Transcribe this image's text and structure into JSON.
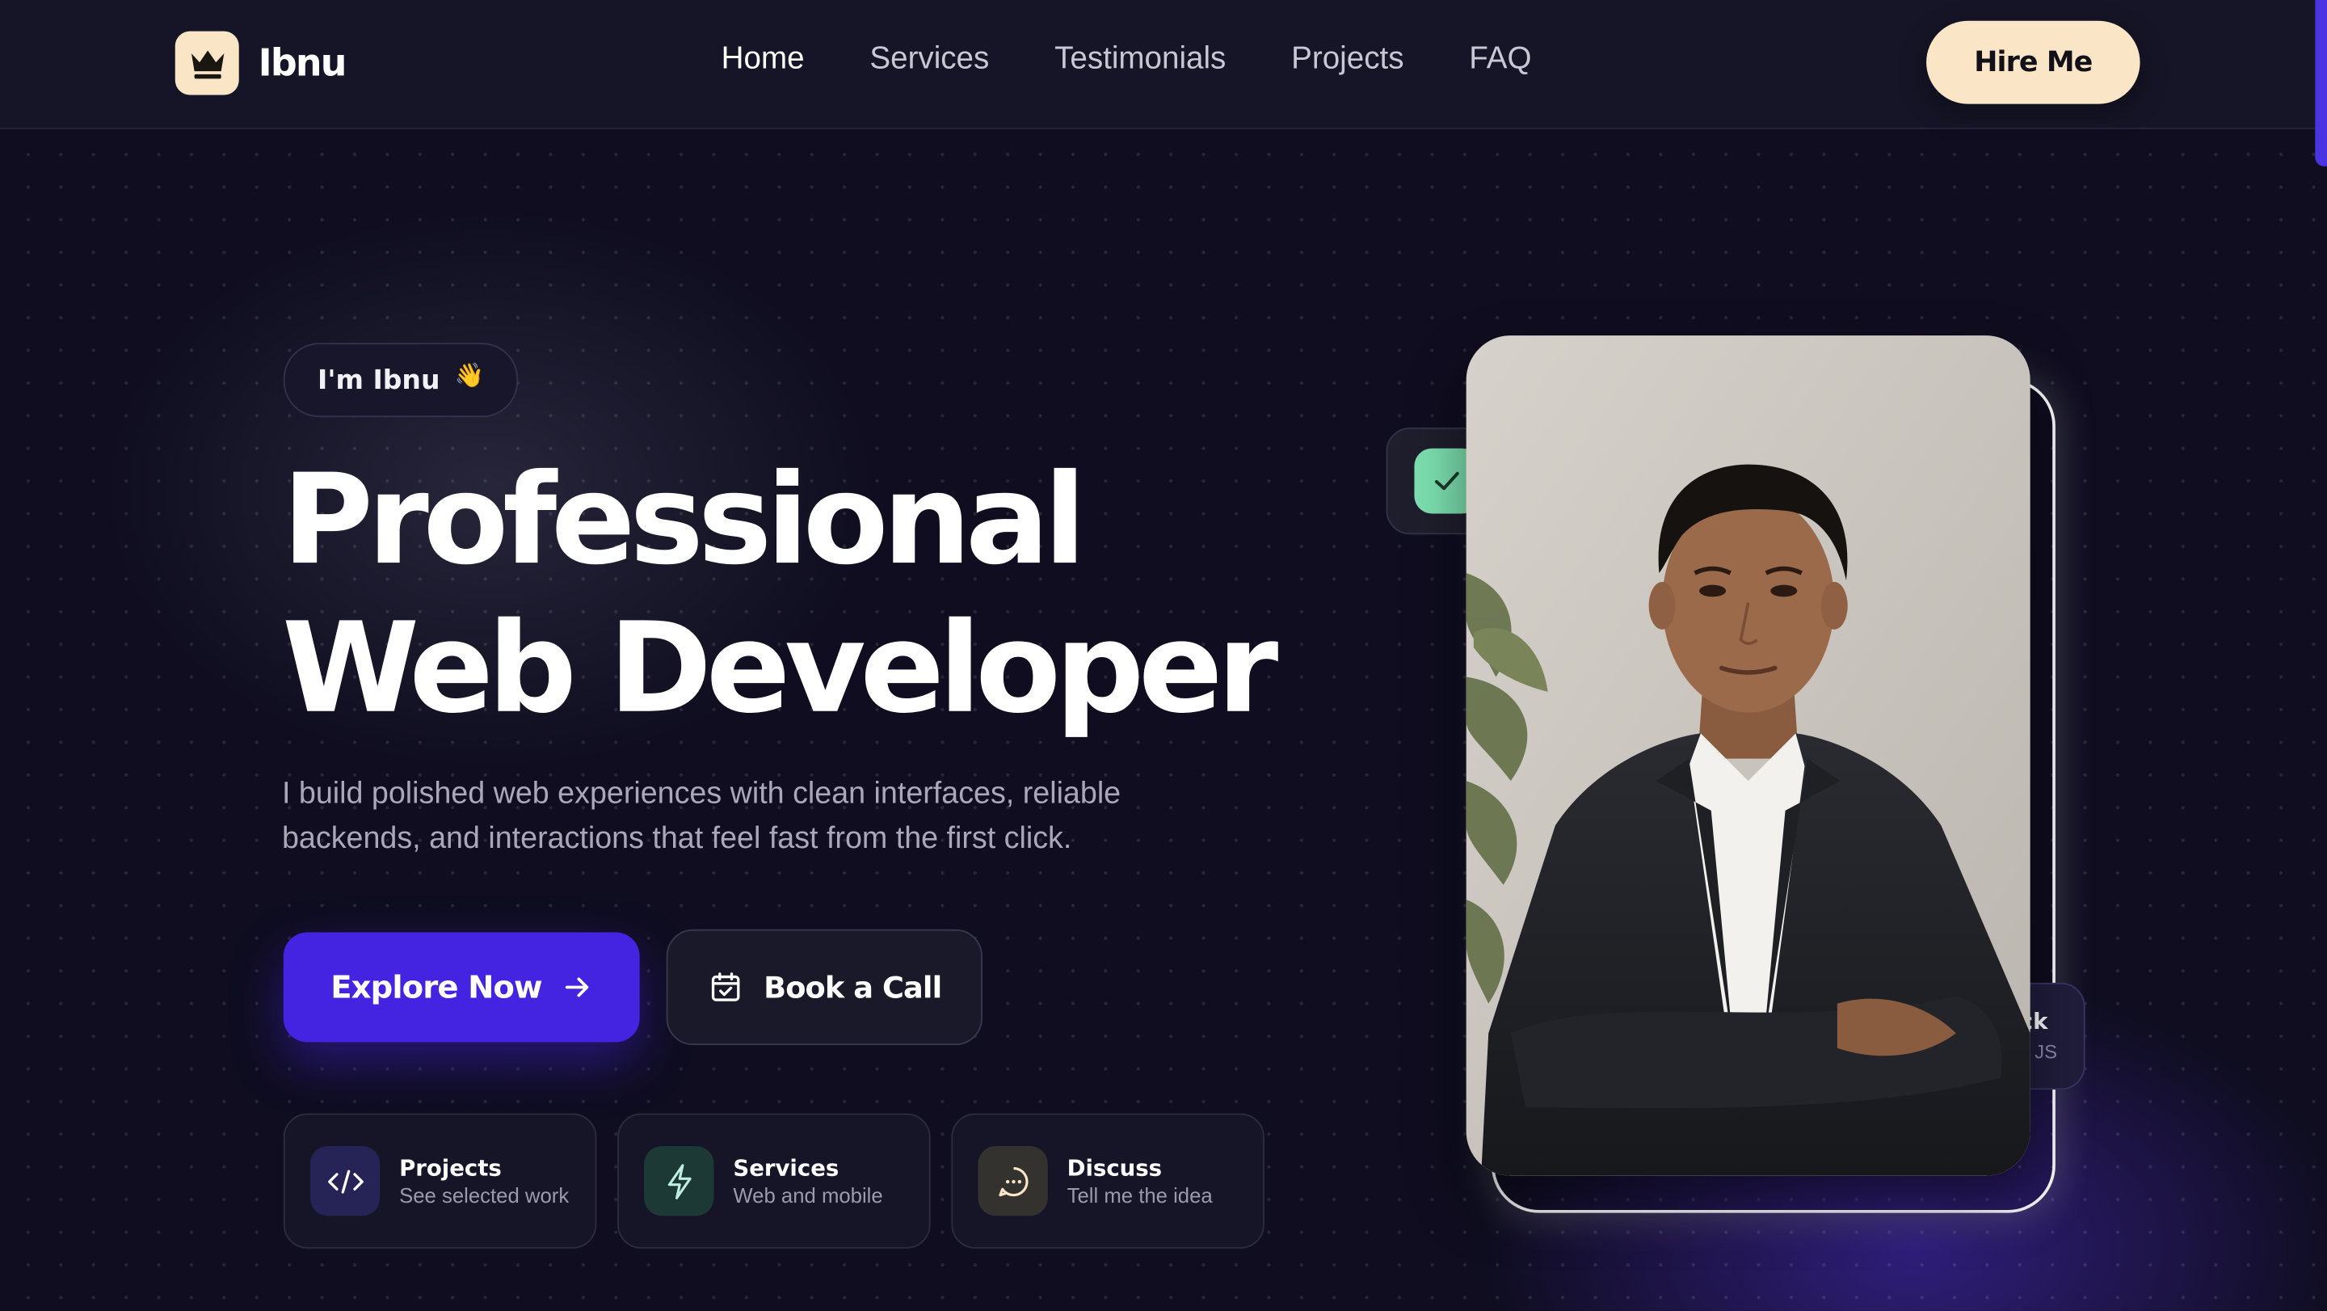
{
  "header": {
    "brand_name": "Ibnu",
    "nav": [
      {
        "label": "Home",
        "active": true
      },
      {
        "label": "Services",
        "active": false
      },
      {
        "label": "Testimonials",
        "active": false
      },
      {
        "label": "Projects",
        "active": false
      },
      {
        "label": "FAQ",
        "active": false
      }
    ],
    "hire_label": "Hire Me"
  },
  "hero": {
    "intro_pill": "I'm Ibnu",
    "headline_line1": "Professional",
    "headline_line2": "Web Developer",
    "description": "I build polished web experiences with clean interfaces, reliable backends, and interactions that feel fast from the first click.",
    "explore_label": "Explore Now",
    "call_label": "Book a Call",
    "cards": [
      {
        "title": "Projects",
        "subtitle": "See selected work",
        "icon": "code-icon"
      },
      {
        "title": "Services",
        "subtitle": "Web and mobile",
        "icon": "lightning-icon"
      },
      {
        "title": "Discuss",
        "subtitle": "Tell me the idea",
        "icon": "chat-icon"
      }
    ]
  },
  "portrait": {
    "badge_right_title": "ck",
    "badge_right_sub": "JS"
  },
  "colors": {
    "accent": "#4424e0",
    "cream": "#fae6c7",
    "background": "#0f0d1f",
    "check_green": "#7de0b0"
  }
}
